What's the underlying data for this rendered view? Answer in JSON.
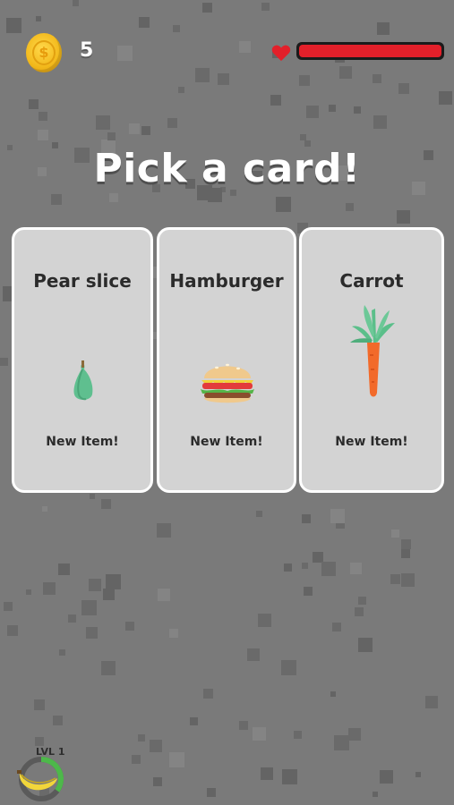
{
  "hud": {
    "coin_icon": "coin-icon",
    "coin_count": "5",
    "heart_icon": "heart-icon",
    "health_fraction": 1.0,
    "health_color": "#e3202a"
  },
  "title": "Pick a card!",
  "cards": [
    {
      "name": "Pear slice",
      "tag": "New Item!",
      "icon": "pear-slice-icon"
    },
    {
      "name": "Hamburger",
      "tag": "New Item!",
      "icon": "hamburger-icon"
    },
    {
      "name": "Carrot",
      "tag": "New Item!",
      "icon": "carrot-icon"
    }
  ],
  "level": {
    "label": "LVL 1",
    "icon": "banana-icon",
    "progress_fraction": 0.35
  }
}
